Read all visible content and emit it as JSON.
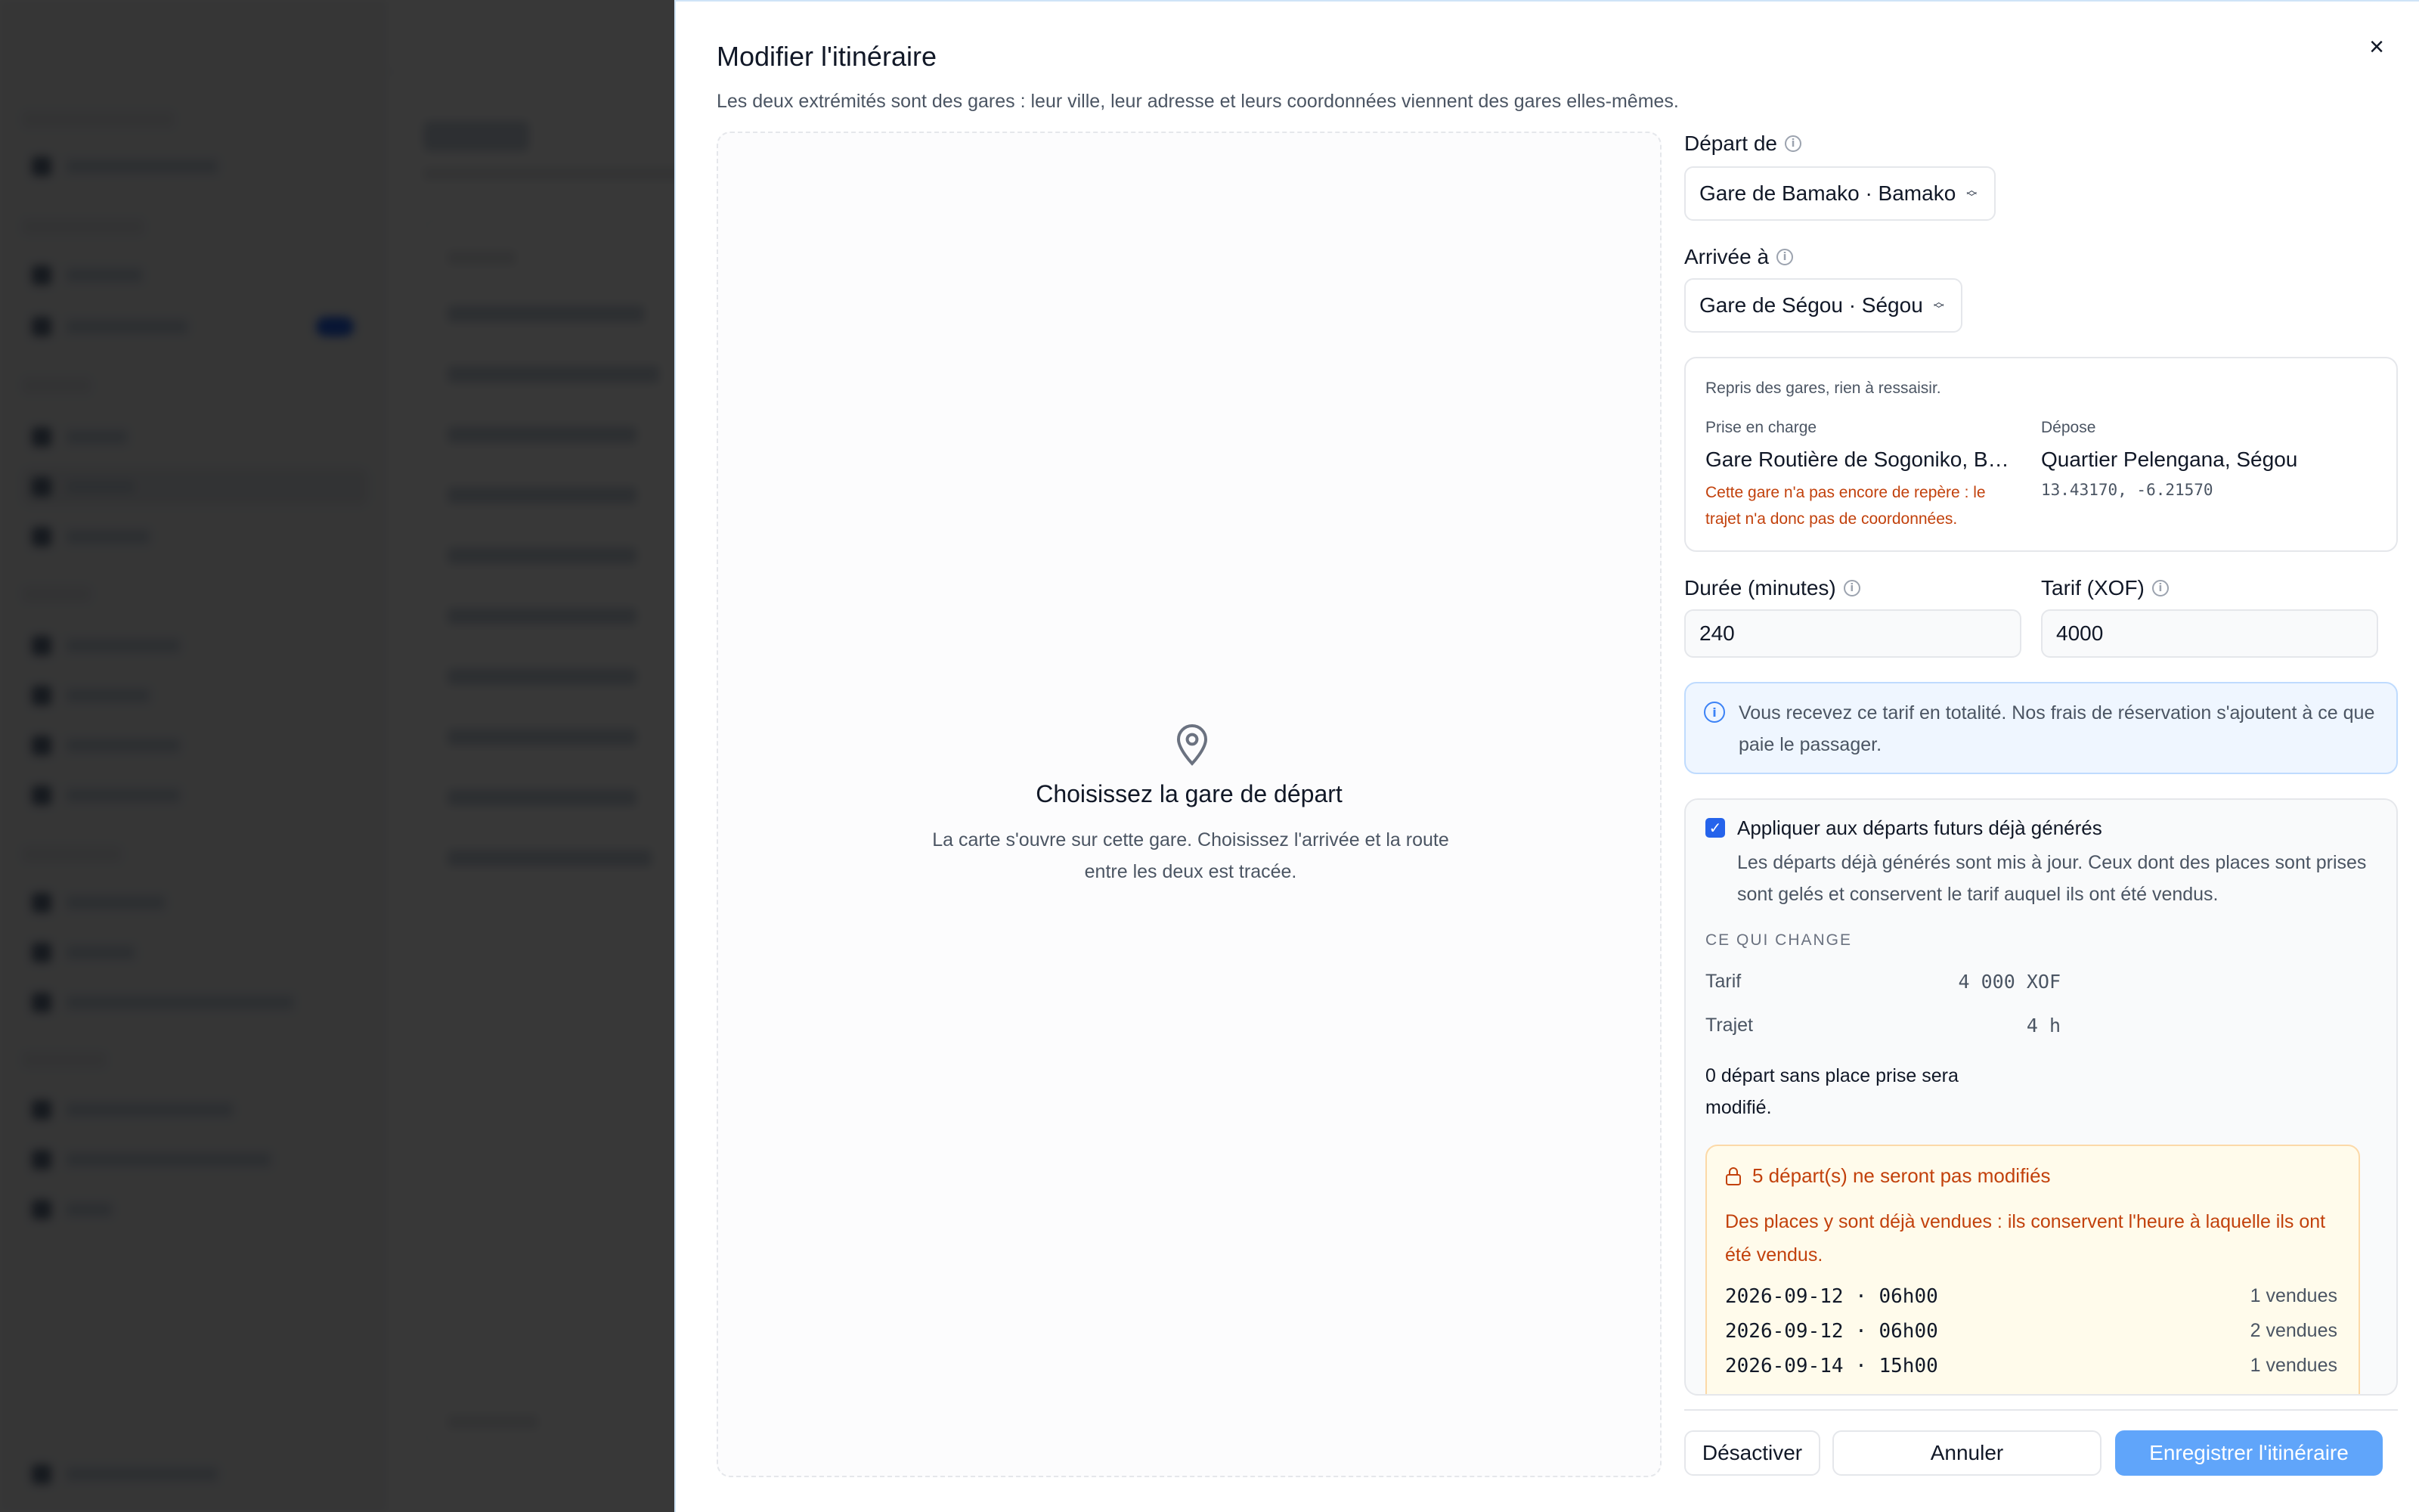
{
  "dialog": {
    "title": "Modifier l'itinéraire",
    "description": "Les deux extrémités sont des gares : leur ville, leur adresse et leurs coordonnées viennent des gares elles-mêmes.",
    "close_symbol": "×"
  },
  "map": {
    "title": "Choisissez la gare de départ",
    "text": "La carte s'ouvre sur cette gare. Choisissez l'arrivée et la route entre les deux est tracée.",
    "icon": "map-pin-icon"
  },
  "form": {
    "departure": {
      "label": "Départ de",
      "value": "Gare de Bamako · Bamako"
    },
    "arrival": {
      "label": "Arrivée à",
      "value": "Gare de Ségou · Ségou"
    },
    "stations": {
      "note": "Repris des gares, rien à ressaisir.",
      "pickup_label": "Prise en charge",
      "pickup_value": "Gare Routière de Sogoniko, Ba...",
      "pickup_warning": "Cette gare n'a pas encore de repère : le trajet n'a donc pas de coordonnées.",
      "dropoff_label": "Dépose",
      "dropoff_value": "Quartier Pelengana, Ségou",
      "dropoff_coords": "13.43170, -6.21570"
    },
    "duration": {
      "label": "Durée (minutes)",
      "value": "240"
    },
    "fare": {
      "label": "Tarif (XOF)",
      "value": "4000"
    },
    "info": "Vous recevez ce tarif en totalité. Nos frais de réservation s'ajoutent à ce que paie le passager."
  },
  "apply": {
    "checked": true,
    "title": "Appliquer aux départs futurs déjà générés",
    "description": "Les départs déjà générés sont mis à jour. Ceux dont des places sont prises sont gelés et conservent le tarif auquel ils ont été vendus.",
    "section": "CE QUI CHANGE",
    "changes": [
      {
        "label": "Tarif",
        "value": "4 000 XOF"
      },
      {
        "label": "Trajet",
        "value": "4 h"
      }
    ],
    "summary": "0 départ sans place prise sera modifié.",
    "warning": {
      "title": "5 départ(s) ne seront pas modifiés",
      "text": "Des places y sont déjà vendues : ils conservent l'heure à laquelle ils ont été vendus.",
      "items": [
        {
          "date": "2026-09-12 · 06h00",
          "sold": "1 vendues"
        },
        {
          "date": "2026-09-12 · 06h00",
          "sold": "2 vendues"
        },
        {
          "date": "2026-09-14 · 15h00",
          "sold": "1 vendues"
        }
      ]
    }
  },
  "footer": {
    "deactivate": "Désactiver",
    "cancel": "Annuler",
    "save": "Enregistrer l'itinéraire"
  },
  "colors": {
    "primary": "#60a5fa",
    "checkbox": "#2563eb",
    "warning_text": "#c2410c",
    "warning_bg": "#fffbeb",
    "info_bg": "#eff6ff"
  }
}
